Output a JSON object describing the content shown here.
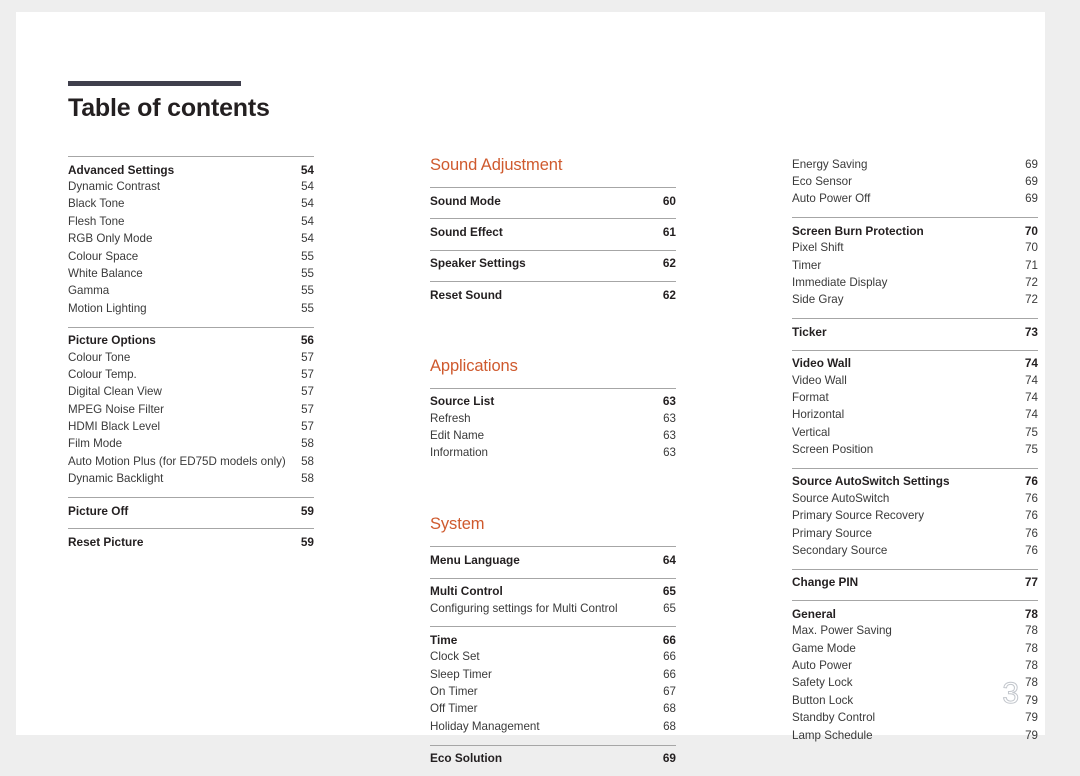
{
  "document": {
    "title": "Table of contents",
    "folio": "3"
  },
  "colors": {
    "section_heading": "#cf5a2e",
    "rule": "#a6a6a6",
    "title_bar": "#3f3f4c",
    "body_text": "#3a3a3a",
    "page_background": "#ffffff",
    "canvas_background": "#eeeeee"
  },
  "columns": [
    {
      "name": "column-1",
      "heading": null,
      "groups": [
        {
          "rule": true,
          "rows": [
            {
              "label": "Advanced Settings",
              "page": "54",
              "bold": true
            },
            {
              "label": "Dynamic Contrast",
              "page": "54",
              "bold": false
            },
            {
              "label": "Black Tone",
              "page": "54",
              "bold": false
            },
            {
              "label": "Flesh Tone",
              "page": "54",
              "bold": false
            },
            {
              "label": "RGB Only Mode",
              "page": "54",
              "bold": false
            },
            {
              "label": "Colour Space",
              "page": "55",
              "bold": false
            },
            {
              "label": "White Balance",
              "page": "55",
              "bold": false
            },
            {
              "label": "Gamma",
              "page": "55",
              "bold": false
            },
            {
              "label": "Motion Lighting",
              "page": "55",
              "bold": false
            }
          ]
        },
        {
          "rule": true,
          "rows": [
            {
              "label": "Picture Options",
              "page": "56",
              "bold": true
            },
            {
              "label": "Colour Tone",
              "page": "57",
              "bold": false
            },
            {
              "label": "Colour Temp.",
              "page": "57",
              "bold": false
            },
            {
              "label": "Digital Clean View",
              "page": "57",
              "bold": false
            },
            {
              "label": "MPEG Noise Filter",
              "page": "57",
              "bold": false
            },
            {
              "label": "HDMI Black Level",
              "page": "57",
              "bold": false
            },
            {
              "label": "Film Mode",
              "page": "58",
              "bold": false
            },
            {
              "label": "Auto Motion Plus (for ED75D models only)",
              "page": "58",
              "bold": false
            },
            {
              "label": "Dynamic Backlight",
              "page": "58",
              "bold": false
            }
          ]
        },
        {
          "rule": true,
          "rows": [
            {
              "label": "Picture Off",
              "page": "59",
              "bold": true
            }
          ]
        },
        {
          "rule": true,
          "rows": [
            {
              "label": "Reset Picture",
              "page": "59",
              "bold": true
            }
          ]
        }
      ]
    },
    {
      "name": "column-2",
      "heading": "Sound Adjustment",
      "groups": [
        {
          "rule": true,
          "rows": [
            {
              "label": "Sound Mode",
              "page": "60",
              "bold": true
            }
          ]
        },
        {
          "rule": true,
          "rows": [
            {
              "label": "Sound Effect",
              "page": "61",
              "bold": true
            }
          ]
        },
        {
          "rule": true,
          "rows": [
            {
              "label": "Speaker Settings",
              "page": "62",
              "bold": true
            }
          ]
        },
        {
          "rule": true,
          "rows": [
            {
              "label": "Reset Sound",
              "page": "62",
              "bold": true
            }
          ]
        }
      ],
      "sections": [
        {
          "heading": "Applications",
          "groups": [
            {
              "rule": true,
              "rows": [
                {
                  "label": "Source List",
                  "page": "63",
                  "bold": true
                },
                {
                  "label": "Refresh",
                  "page": "63",
                  "bold": false
                },
                {
                  "label": "Edit Name",
                  "page": "63",
                  "bold": false
                },
                {
                  "label": "Information",
                  "page": "63",
                  "bold": false
                }
              ]
            }
          ]
        },
        {
          "heading": "System",
          "groups": [
            {
              "rule": true,
              "rows": [
                {
                  "label": "Menu Language",
                  "page": "64",
                  "bold": true
                }
              ]
            },
            {
              "rule": true,
              "rows": [
                {
                  "label": "Multi Control",
                  "page": "65",
                  "bold": true
                },
                {
                  "label": "Configuring settings for Multi Control",
                  "page": "65",
                  "bold": false
                }
              ]
            },
            {
              "rule": true,
              "rows": [
                {
                  "label": "Time",
                  "page": "66",
                  "bold": true
                },
                {
                  "label": "Clock Set",
                  "page": "66",
                  "bold": false
                },
                {
                  "label": "Sleep Timer",
                  "page": "66",
                  "bold": false
                },
                {
                  "label": "On Timer",
                  "page": "67",
                  "bold": false
                },
                {
                  "label": "Off Timer",
                  "page": "68",
                  "bold": false
                },
                {
                  "label": "Holiday Management",
                  "page": "68",
                  "bold": false
                }
              ]
            },
            {
              "rule": true,
              "rows": [
                {
                  "label": "Eco Solution",
                  "page": "69",
                  "bold": true
                }
              ]
            }
          ]
        }
      ]
    },
    {
      "name": "column-3",
      "heading": null,
      "groups": [
        {
          "rule": false,
          "rows": [
            {
              "label": "Energy Saving",
              "page": "69",
              "bold": false
            },
            {
              "label": "Eco Sensor",
              "page": "69",
              "bold": false
            },
            {
              "label": "Auto Power Off",
              "page": "69",
              "bold": false
            }
          ]
        },
        {
          "rule": true,
          "rows": [
            {
              "label": "Screen Burn Protection",
              "page": "70",
              "bold": true
            },
            {
              "label": "Pixel Shift",
              "page": "70",
              "bold": false
            },
            {
              "label": "Timer",
              "page": "71",
              "bold": false
            },
            {
              "label": "Immediate Display",
              "page": "72",
              "bold": false
            },
            {
              "label": "Side Gray",
              "page": "72",
              "bold": false
            }
          ]
        },
        {
          "rule": true,
          "rows": [
            {
              "label": "Ticker",
              "page": "73",
              "bold": true
            }
          ]
        },
        {
          "rule": true,
          "rows": [
            {
              "label": "Video Wall",
              "page": "74",
              "bold": true
            },
            {
              "label": "Video Wall",
              "page": "74",
              "bold": false
            },
            {
              "label": "Format",
              "page": "74",
              "bold": false
            },
            {
              "label": "Horizontal",
              "page": "74",
              "bold": false
            },
            {
              "label": "Vertical",
              "page": "75",
              "bold": false
            },
            {
              "label": "Screen Position",
              "page": "75",
              "bold": false
            }
          ]
        },
        {
          "rule": true,
          "rows": [
            {
              "label": "Source AutoSwitch Settings",
              "page": "76",
              "bold": true
            },
            {
              "label": "Source AutoSwitch",
              "page": "76",
              "bold": false
            },
            {
              "label": "Primary Source Recovery",
              "page": "76",
              "bold": false
            },
            {
              "label": "Primary Source",
              "page": "76",
              "bold": false
            },
            {
              "label": "Secondary Source",
              "page": "76",
              "bold": false
            }
          ]
        },
        {
          "rule": true,
          "rows": [
            {
              "label": "Change PIN",
              "page": "77",
              "bold": true
            }
          ]
        },
        {
          "rule": true,
          "rows": [
            {
              "label": "General",
              "page": "78",
              "bold": true
            },
            {
              "label": "Max. Power Saving",
              "page": "78",
              "bold": false
            },
            {
              "label": "Game Mode",
              "page": "78",
              "bold": false
            },
            {
              "label": "Auto Power",
              "page": "78",
              "bold": false
            },
            {
              "label": "Safety Lock",
              "page": "78",
              "bold": false
            },
            {
              "label": "Button Lock",
              "page": "79",
              "bold": false
            },
            {
              "label": "Standby Control",
              "page": "79",
              "bold": false
            },
            {
              "label": "Lamp Schedule",
              "page": "79",
              "bold": false
            }
          ]
        }
      ]
    }
  ]
}
